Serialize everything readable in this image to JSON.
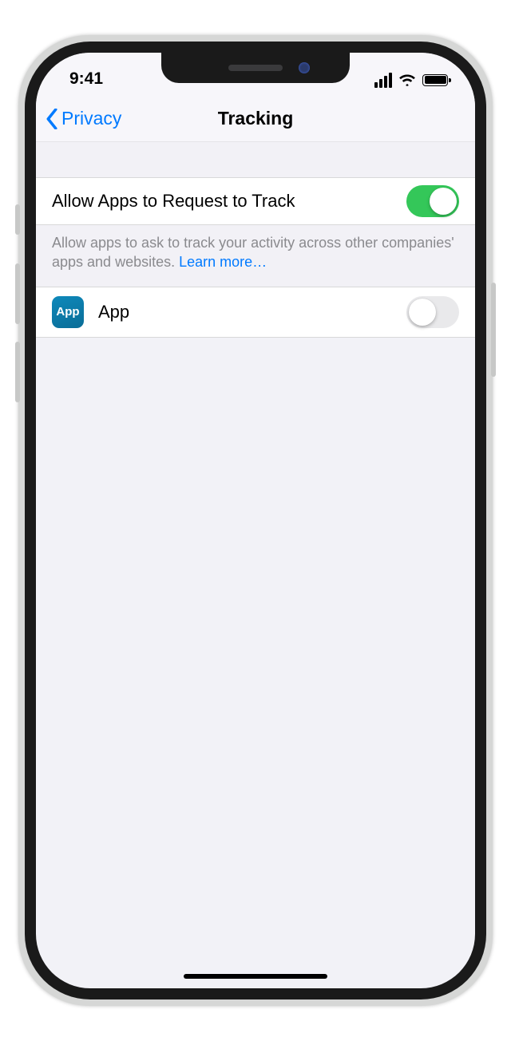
{
  "status": {
    "time": "9:41"
  },
  "nav": {
    "back_label": "Privacy",
    "title": "Tracking"
  },
  "settings": {
    "allow_request": {
      "label": "Allow Apps to Request to Track",
      "on": true
    },
    "footer_text": "Allow apps to ask to track your activity across other companies' apps and websites. ",
    "learn_more": "Learn more…"
  },
  "apps": [
    {
      "icon_label": "App",
      "name": "App",
      "tracking_on": false
    }
  ]
}
